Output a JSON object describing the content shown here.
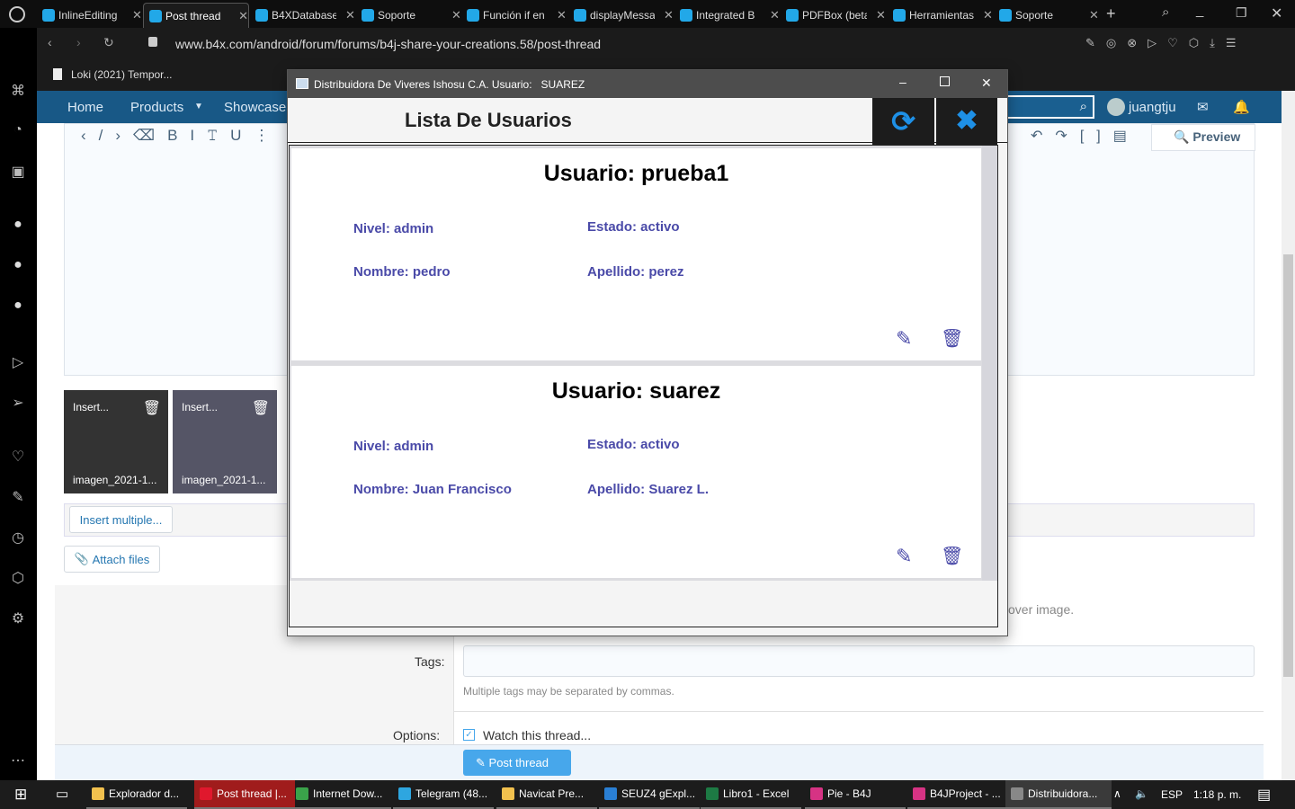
{
  "browser": {
    "tabs": [
      {
        "label": "InlineEditing",
        "active": false
      },
      {
        "label": "Post thread",
        "active": true
      },
      {
        "label": "B4XDatabase",
        "active": false
      },
      {
        "label": "Soporte",
        "active": false
      },
      {
        "label": "Función if en",
        "active": false
      },
      {
        "label": "displayMessage",
        "active": false
      },
      {
        "label": "Integrated B",
        "active": false
      },
      {
        "label": "PDFBox (beta",
        "active": false
      },
      {
        "label": "Herramientas",
        "active": false
      },
      {
        "label": "Soporte",
        "active": false
      }
    ],
    "url": "www.b4x.com/android/forum/forums/b4j-share-your-creations.58/post-thread",
    "bookmark": "Loki (2021) Tempor..."
  },
  "site": {
    "nav": [
      "Home",
      "Products",
      "Showcase"
    ],
    "user": "juangtju",
    "preview": "Preview",
    "attachments": [
      {
        "overlay": "Insert...",
        "name": "imagen_2021-1..."
      },
      {
        "overlay": "Insert...",
        "name": "imagen_2021-1..."
      }
    ],
    "insert_multiple": "Insert multiple...",
    "attach_files": "Attach files",
    "cover_hint": "over image.",
    "tags_label": "Tags:",
    "tags_value": "",
    "tags_hint": "Multiple tags may be separated by commas.",
    "options_label": "Options:",
    "watch_label": "Watch this thread...",
    "watch_checked": true,
    "post_button": "Post thread"
  },
  "dialog": {
    "title": "Distribuidora De Viveres Ishosu C.A. Usuario:   SUAREZ",
    "heading": "Lista De Usuarios",
    "accent": "#1e90e6",
    "field_color": "#4a4aa8",
    "users": [
      {
        "title": "Usuario: prueba1",
        "nivel": "Nivel: admin",
        "estado": "Estado: activo",
        "nombre": "Nombre: pedro",
        "apellido": "Apellido: perez"
      },
      {
        "title": "Usuario: suarez",
        "nivel": "Nivel: admin",
        "estado": "Estado: activo",
        "nombre": "Nombre: Juan Francisco",
        "apellido": "Apellido: Suarez L."
      }
    ]
  },
  "taskbar": {
    "items": [
      {
        "label": "Explorador d...",
        "color": "#f2c14e"
      },
      {
        "label": "Post thread |...",
        "color": "#e0182d",
        "active": true
      },
      {
        "label": "Internet Dow...",
        "color": "#3aa34a"
      },
      {
        "label": "Telegram (48...",
        "color": "#2ea6e0"
      },
      {
        "label": "Navicat Pre...",
        "color": "#f2c14e"
      },
      {
        "label": "SEUZ4 gExpl...",
        "color": "#2a7fd4"
      },
      {
        "label": "Libro1 - Excel",
        "color": "#1d7a44"
      },
      {
        "label": "Pie - B4J",
        "color": "#d63384"
      },
      {
        "label": "B4JProject - ...",
        "color": "#d63384"
      },
      {
        "label": "Distribuidora...",
        "color": "#888888"
      }
    ],
    "lang": "ESP",
    "time": "1:18 p. m."
  }
}
